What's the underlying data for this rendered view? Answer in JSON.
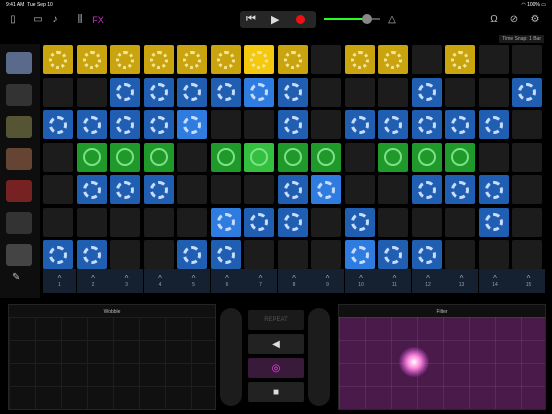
{
  "status": {
    "time": "9:41 AM",
    "date": "Tue Sep 10",
    "battery": "100%"
  },
  "toolbar": {
    "fx_label": "FX",
    "time_snap": "Time Snap: 1 Bar"
  },
  "icons": [
    "song-browser-icon",
    "tracks-icon",
    "mic-icon",
    "mixer-icon",
    "fx-icon",
    "rewind-icon",
    "play-icon",
    "record-icon",
    "metronome-icon",
    "headphones-icon",
    "help-icon",
    "settings-icon"
  ],
  "instruments": [
    "sampler",
    "turntable",
    "keyboard",
    "synth",
    "red-keys",
    "gong",
    "drum-machine"
  ],
  "grid": {
    "rows": [
      [
        "y",
        "y",
        "y",
        "y",
        "y",
        "y",
        "Y",
        "y",
        "n",
        "y",
        "y",
        "n",
        "y",
        "n",
        "n"
      ],
      [
        "n",
        "n",
        "b",
        "b",
        "b",
        "b",
        "B",
        "b",
        "n",
        "n",
        "n",
        "b",
        "n",
        "n",
        "b"
      ],
      [
        "b",
        "b",
        "b",
        "b",
        "B",
        "n",
        "n",
        "b",
        "n",
        "b",
        "b",
        "b",
        "b",
        "b",
        "n"
      ],
      [
        "n",
        "g",
        "g",
        "g",
        "n",
        "g",
        "G",
        "g",
        "g",
        "n",
        "g",
        "g",
        "g",
        "n",
        "n"
      ],
      [
        "n",
        "b",
        "b",
        "b",
        "n",
        "n",
        "n",
        "b",
        "B",
        "n",
        "n",
        "b",
        "b",
        "b",
        "n"
      ],
      [
        "n",
        "n",
        "n",
        "n",
        "n",
        "B",
        "b",
        "b",
        "n",
        "b",
        "n",
        "n",
        "n",
        "b",
        "n"
      ],
      [
        "b",
        "b",
        "n",
        "n",
        "b",
        "b",
        "n",
        "n",
        "n",
        "B",
        "b",
        "b",
        "n",
        "n",
        "n"
      ]
    ]
  },
  "triggers": [
    "1",
    "2",
    "3",
    "4",
    "5",
    "6",
    "7",
    "8",
    "9",
    "10",
    "11",
    "12",
    "13",
    "14",
    "15"
  ],
  "wobble": {
    "title": "Wobble"
  },
  "filter": {
    "title": "Filter"
  },
  "controls": {
    "repeat_label": "REPEAT"
  }
}
